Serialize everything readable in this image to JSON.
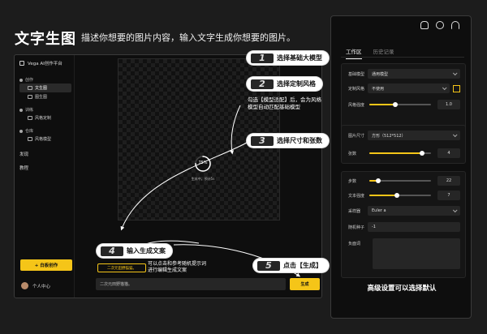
{
  "header": {
    "title": "文字生图",
    "subtitle": "描述你想要的图片内容，输入文字生成你想要的图片。"
  },
  "app": {
    "brand": "Vega AI创作平台",
    "nav": [
      {
        "label": "创作",
        "kind": "group"
      },
      {
        "label": "文生图",
        "kind": "item",
        "active": true
      },
      {
        "label": "图生图",
        "kind": "item"
      },
      {
        "label": "训练",
        "kind": "group"
      },
      {
        "label": "风格定制",
        "kind": "item"
      },
      {
        "label": "仓库",
        "kind": "group"
      },
      {
        "label": "风格模型",
        "kind": "item"
      }
    ],
    "links": [
      "发现",
      "教程"
    ],
    "create_button": "+ 白板创作",
    "user_name": "个人中心",
    "progress": {
      "percent": 75,
      "label": "75%",
      "status": "生成中，预计5s"
    },
    "hint_chip": "二次元田野猫猫。",
    "hint_note": [
      "可以点击和参考随机提示词",
      "进行编辑生成文案"
    ],
    "prompt_value": "二次元田野猫猫。",
    "generate_button": "生成"
  },
  "callouts": [
    {
      "num": "1",
      "text": "选择基础大模型"
    },
    {
      "num": "2",
      "text": "选择定制风格"
    },
    {
      "num": "3",
      "text": "选择尺寸和张数"
    },
    {
      "num": "4",
      "text": "输入生成文案"
    },
    {
      "num": "5",
      "text": "点击【生成】"
    }
  ],
  "callout_note_2": [
    "勾选【模型适配】后，会为风格",
    "模型自动匹配基础模型"
  ],
  "panel": {
    "icons": [
      "bell-icon",
      "gear-icon",
      "headset-icon"
    ],
    "tabs": [
      "工作区",
      "历史记录"
    ],
    "active_tab": 0,
    "base_model": {
      "label": "基础模型",
      "value": "通用模型"
    },
    "custom_style": {
      "label": "定制风格",
      "value": "不使用"
    },
    "style_strength": {
      "label": "风格强度",
      "value": "1.0",
      "level": 0.42
    },
    "image_size": {
      "label": "图片尺寸",
      "value": "方形（512*512）"
    },
    "count": {
      "label": "张数",
      "value": "4",
      "level": 0.85
    },
    "steps": {
      "label": "步数",
      "value": "22",
      "level": 0.15
    },
    "text_strength": {
      "label": "文本强度",
      "value": "7",
      "level": 0.45
    },
    "sampler": {
      "label": "采样器",
      "value": "Euler a"
    },
    "seed": {
      "label": "随机种子",
      "value": "-1"
    },
    "negative": {
      "label": "负面词"
    },
    "footer": "高级设置可以选择默认"
  },
  "colors": {
    "accent": "#f5c518",
    "bg": "#1c1c1c",
    "panel": "#0e0e0e"
  }
}
